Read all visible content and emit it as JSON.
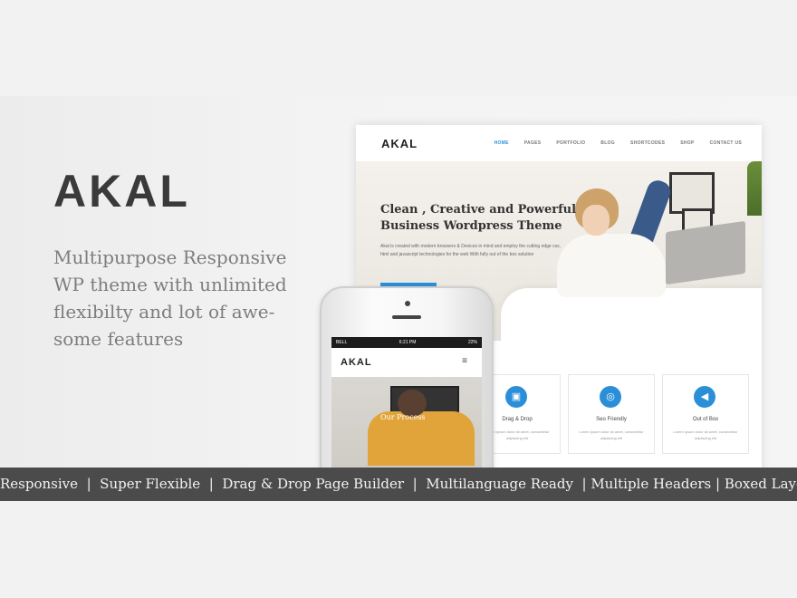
{
  "brand": "AKAL",
  "tagline_lines": [
    "Multipurpose Responsive",
    "WP theme with unlimited",
    "flexibilty and lot of awe-",
    "some features"
  ],
  "desktop": {
    "logo": "AKAL",
    "menu": [
      "HOME",
      "PAGES",
      "PORTFOLIO",
      "BLOG",
      "SHORTCODES",
      "SHOP",
      "CONTACT US"
    ],
    "hero_title": "Clean , Creative and Powerful Business Wordpress Theme",
    "hero_text": "Akal is created with modern browsers & Devices in mind and employ the cutting edge css, html and javascript technologies for the web With fully out of the box solution",
    "features": [
      {
        "title": "Drag & Drop",
        "desc": "Lorem ipsum dolor sit amet, consectetur adipiscing elit",
        "icon": "cube-icon"
      },
      {
        "title": "Seo Friendly",
        "desc": "Lorem ipsum dolor sit amet, consectetur adipiscing elit",
        "icon": "globe-icon"
      },
      {
        "title": "Out of Box",
        "desc": "Lorem ipsum dolor sit amet, consectetur adipiscing elit",
        "icon": "megaphone-icon"
      }
    ]
  },
  "phone": {
    "carrier": "BELL",
    "time": "6:21 PM",
    "battery": "22%",
    "logo": "AKAL",
    "menu_icon": "≡",
    "caption": "Our Process"
  },
  "strip_items": [
    "Responsive",
    "Super Flexible",
    "Drag & Drop Page Builder",
    "Multilanguage Ready",
    "Multiple Headers",
    "Boxed Layout"
  ],
  "colors": {
    "accent": "#2b8fd8",
    "strip": "#4b4b4b",
    "background": "#f2f2f2"
  }
}
